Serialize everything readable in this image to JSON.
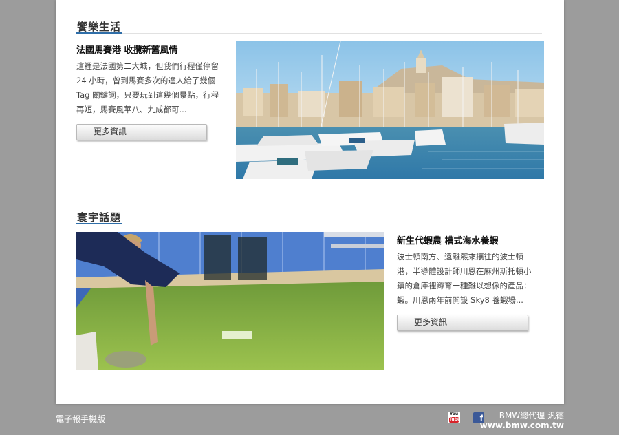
{
  "sections": [
    {
      "heading": "饗樂生活",
      "article": {
        "title": "法國馬賽港 收攬新舊風情",
        "body": "這裡是法國第二大城，但我們行程僅停留 24 小時，曾到馬賽多次的達人給了幾個 Tag 關鍵詞，只要玩到這幾個景點，行程再短，馬賽風華八、九成都可...",
        "more_label": "更多資訊",
        "image": "marseille-harbor-photo"
      }
    },
    {
      "heading": "寰宇話題",
      "article": {
        "title": "新生代蝦農 槽式海水養蝦",
        "body": "波士頓南方、遠離熙來攘往的波士頓港，半導體設計師川恩在麻州斯托頓小鎮的倉庫裡孵育一種難以想像的產品：蝦。川恩兩年前開設 Sky8 養蝦場...",
        "more_label": "更多資訊",
        "image": "shrimp-tank-photo"
      }
    }
  ],
  "footer": {
    "mobile_label": "電子報手機版",
    "youtube_top": "You",
    "youtube_bottom": "Tube",
    "facebook_glyph": "f",
    "dealer_label": "BMW總代理 汎德",
    "url": "www.bmw.com.tw"
  },
  "colors": {
    "accent": "#2f6ea8",
    "page_bg": "#9c9c9c",
    "panel_bg": "#ffffff"
  }
}
